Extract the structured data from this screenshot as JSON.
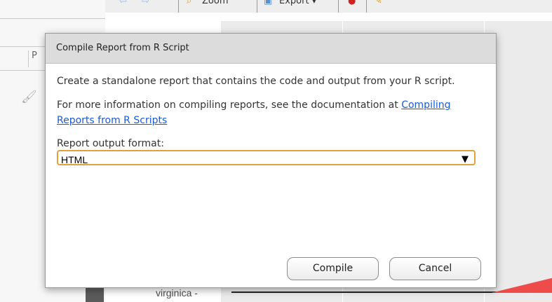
{
  "background": {
    "toolbar": {
      "zoom_label": "Zoom",
      "export_label": "Export ▾"
    },
    "left_tab_label": "P",
    "axis_label": "virginica -"
  },
  "dialog": {
    "title": "Compile Report from R Script",
    "description": "Create a standalone report that contains the code and output from your R script.",
    "info_prefix": "For more information on compiling reports, see the documentation at ",
    "info_link": "Compiling Reports from R Scripts",
    "format_label": "Report output format:",
    "format_value": "HTML",
    "compile_button": "Compile",
    "cancel_button": "Cancel"
  },
  "colors": {
    "select_focus_border": "#e0a23b",
    "link": "#1a5bd6",
    "title_bar": "#dcdcdc"
  }
}
